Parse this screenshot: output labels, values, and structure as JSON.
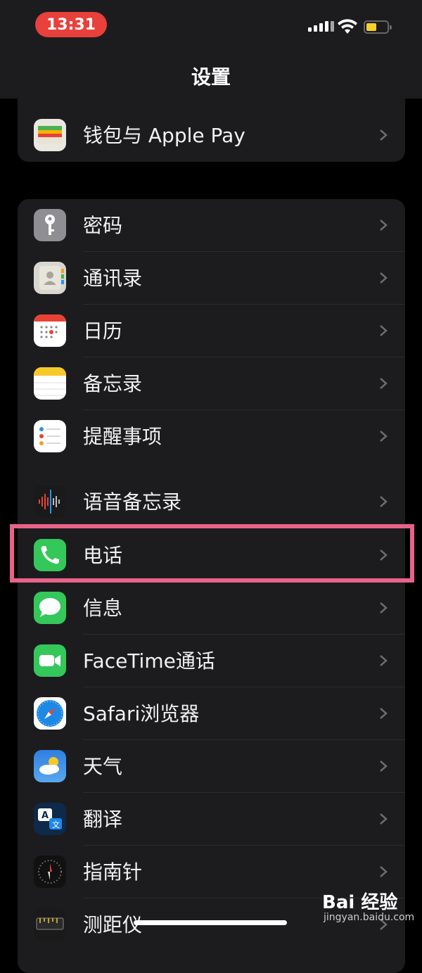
{
  "status_bar": {
    "time": "13:31"
  },
  "nav": {
    "title": "设置"
  },
  "group1": [
    {
      "label": "钱包与 Apple Pay",
      "icon": "wallet-icon"
    }
  ],
  "group2": [
    {
      "label": "密码",
      "icon": "key-icon"
    },
    {
      "label": "通讯录",
      "icon": "contacts-icon"
    },
    {
      "label": "日历",
      "icon": "calendar-icon"
    },
    {
      "label": "备忘录",
      "icon": "notes-icon"
    },
    {
      "label": "提醒事项",
      "icon": "reminders-icon"
    },
    {
      "label": "语音备忘录",
      "icon": "voice-memo-icon"
    },
    {
      "label": "电话",
      "icon": "phone-icon"
    },
    {
      "label": "信息",
      "icon": "messages-icon"
    },
    {
      "label": "FaceTime通话",
      "icon": "facetime-icon"
    },
    {
      "label": "Safari浏览器",
      "icon": "safari-icon"
    },
    {
      "label": "天气",
      "icon": "weather-icon"
    },
    {
      "label": "翻译",
      "icon": "translate-icon"
    },
    {
      "label": "指南针",
      "icon": "compass-icon"
    },
    {
      "label": "测距仪",
      "icon": "measure-icon"
    }
  ],
  "watermark": {
    "main": "Bai 经验",
    "sub": "jingyan.baidu.com"
  },
  "colors": {
    "accent_highlight": "#e8638a",
    "time_pill": "#e8403b",
    "battery": "#f5d02a"
  }
}
